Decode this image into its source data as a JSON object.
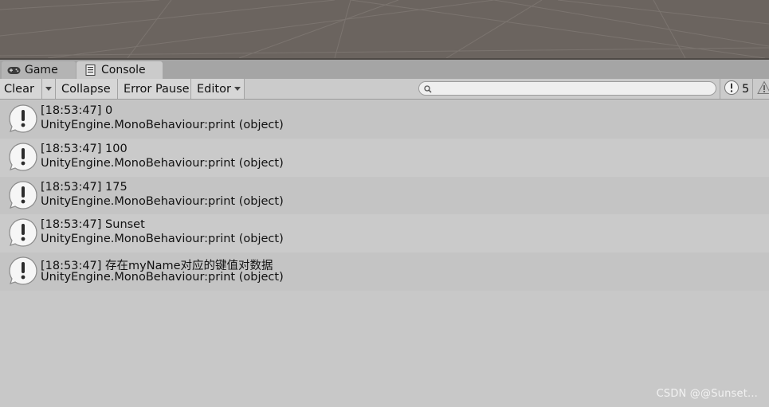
{
  "tabs": {
    "game": {
      "label": "Game",
      "icon": "gamepad-icon"
    },
    "console": {
      "label": "Console",
      "icon": "console-icon"
    }
  },
  "toolbar": {
    "clear_label": "Clear",
    "collapse_label": "Collapse",
    "error_pause_label": "Error Pause",
    "editor_label": "Editor",
    "search_placeholder": "",
    "info_count": "5"
  },
  "log": {
    "entries": [
      {
        "message": "[18:53:47] 0",
        "stack": "UnityEngine.MonoBehaviour:print (object)"
      },
      {
        "message": "[18:53:47] 100",
        "stack": "UnityEngine.MonoBehaviour:print (object)"
      },
      {
        "message": "[18:53:47] 175",
        "stack": "UnityEngine.MonoBehaviour:print (object)"
      },
      {
        "message": "[18:53:47] Sunset",
        "stack": "UnityEngine.MonoBehaviour:print (object)"
      },
      {
        "message": "[18:53:47] 存在myName对应的键值对数据",
        "stack": "UnityEngine.MonoBehaviour:print (object)"
      }
    ]
  },
  "watermark": "CSDN @@Sunset...",
  "colors": {
    "scene_bg": "#6b645f",
    "panel_bg": "#c8c8c8",
    "tab_active": "#cbcbcb",
    "tab_inactive": "#b4b4b4"
  }
}
